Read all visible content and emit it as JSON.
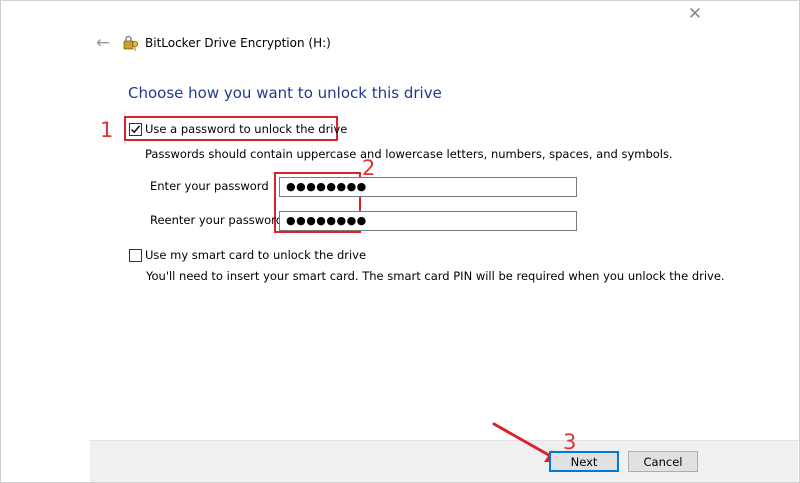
{
  "window": {
    "title": "BitLocker Drive Encryption (H:)",
    "close_glyph": "✕",
    "back_glyph": "←",
    "icon": "bitlocker-key-icon"
  },
  "heading": "Choose how you want to unlock this drive",
  "password_option": {
    "label": "Use a password to unlock the drive",
    "checked": true,
    "hint": "Passwords should contain uppercase and lowercase letters, numbers, spaces, and symbols.",
    "enter_label": "Enter your password",
    "enter_value": "●●●●●●●●",
    "reenter_label": "Reenter your password",
    "reenter_value": "●●●●●●●●"
  },
  "smartcard_option": {
    "label": "Use my smart card to unlock the drive",
    "checked": false,
    "hint": "You'll need to insert your smart card. The smart card PIN will be required when you unlock the drive."
  },
  "buttons": {
    "next": "Next",
    "cancel": "Cancel"
  },
  "annotations": {
    "step1": "1",
    "step2": "2",
    "step3": "3",
    "color": "#d9232b"
  },
  "colors": {
    "heading": "#1e3b8f",
    "accent": "#0078d7",
    "footer": "#f0f0f0"
  }
}
